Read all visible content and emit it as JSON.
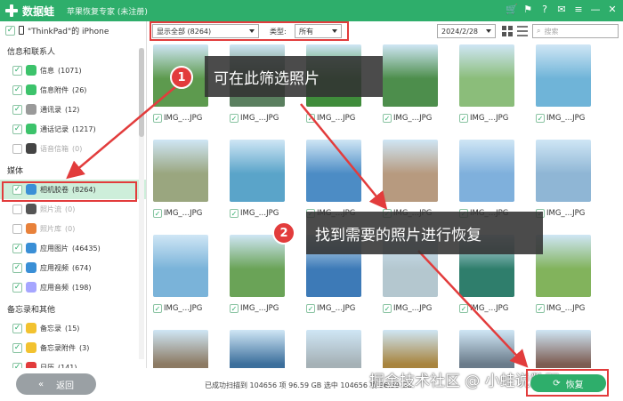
{
  "titlebar": {
    "app_name": "数据蛙",
    "subtitle": "苹果恢复专家 (未注册)",
    "icons": [
      "cart-icon",
      "gift-icon",
      "help-icon",
      "chat-icon",
      "menu-icon",
      "minimize-icon",
      "close-icon"
    ],
    "accent": "#2eae6b"
  },
  "sidebar": {
    "device": "\"ThinkPad\"的 iPhone",
    "sections": [
      {
        "title": "信息和联系人",
        "items": [
          {
            "label": "信息",
            "count": "(1071)",
            "checked": true,
            "icon": "message-icon",
            "color": "#3cc36b"
          },
          {
            "label": "信息附件",
            "count": "(26)",
            "checked": true,
            "icon": "message-attachment-icon",
            "color": "#3cc36b"
          },
          {
            "label": "通讯录",
            "count": "(12)",
            "checked": true,
            "icon": "contacts-icon",
            "color": "#9a9a9a"
          },
          {
            "label": "通话记录",
            "count": "(1217)",
            "checked": true,
            "icon": "phone-icon",
            "color": "#3cc36b"
          },
          {
            "label": "语音信箱",
            "count": "(0)",
            "checked": false,
            "icon": "voicemail-icon",
            "color": "#444444"
          }
        ]
      },
      {
        "title": "媒体",
        "items": [
          {
            "label": "相机胶卷",
            "count": "(8264)",
            "checked": true,
            "icon": "camera-roll-icon",
            "color": "#3a8fd6",
            "selected": true
          },
          {
            "label": "照片流",
            "count": "(0)",
            "checked": false,
            "icon": "photo-stream-icon",
            "color": "#555555"
          },
          {
            "label": "照片库",
            "count": "(0)",
            "checked": false,
            "icon": "photo-library-icon",
            "color": "#e8813a"
          },
          {
            "label": "应用图片",
            "count": "(46435)",
            "checked": true,
            "icon": "app-photos-icon",
            "color": "#3a8fd6"
          },
          {
            "label": "应用视频",
            "count": "(674)",
            "checked": true,
            "icon": "app-videos-icon",
            "color": "#3a8fd6"
          },
          {
            "label": "应用音频",
            "count": "(198)",
            "checked": true,
            "icon": "app-audio-icon",
            "color": "#a6a6ff"
          }
        ]
      },
      {
        "title": "备忘录和其他",
        "items": [
          {
            "label": "备忘录",
            "count": "(15)",
            "checked": true,
            "icon": "notes-icon",
            "color": "#f2c230"
          },
          {
            "label": "备忘录附件",
            "count": "(3)",
            "checked": true,
            "icon": "notes-attachment-icon",
            "color": "#f2c230"
          },
          {
            "label": "日历",
            "count": "(141)",
            "checked": true,
            "icon": "calendar-icon",
            "color": "#e23c3c"
          }
        ]
      }
    ]
  },
  "toolbar": {
    "filter_select": "显示全部 (8264)",
    "type_label": "类型:",
    "type_select": "所有",
    "date_select": "2024/2/28",
    "search_placeholder": "搜索"
  },
  "photos": {
    "caption": "IMG_…JPG",
    "rows": [
      [
        "#5d9a4e",
        "#5a7f5f",
        "#3f8c3b",
        "#4d8e4c",
        "#8bbd7a",
        "#6fb4d8"
      ],
      [
        "#9aa67f",
        "#5aa4c9",
        "#4c8cc5",
        "#b79a7f",
        "#7fb0dc",
        "#8fb6d5"
      ],
      [
        "#7ab3d9",
        "#6aa357",
        "#3d7ab7",
        "#b4c7cf",
        "#2f7e6c",
        "#82b35c"
      ],
      [
        "#8c7a63",
        "#3c6f9c",
        "#a5b1b6",
        "#a8843e",
        "#6a7b8a",
        "#7d5c52"
      ]
    ]
  },
  "annotations": {
    "step1_number": "1",
    "step1_text": "可在此筛选照片",
    "step2_number": "2",
    "step2_text": "找到需要的照片进行恢复",
    "color": "#e23c3c"
  },
  "bottombar": {
    "back_label": "返回",
    "status": "已成功扫描到 104656 项 96.59 GB  选中 104656 项 96.59 GB",
    "recover_label": "恢复",
    "watermark": "掘金技术社区 @ 小蛙说数码"
  }
}
